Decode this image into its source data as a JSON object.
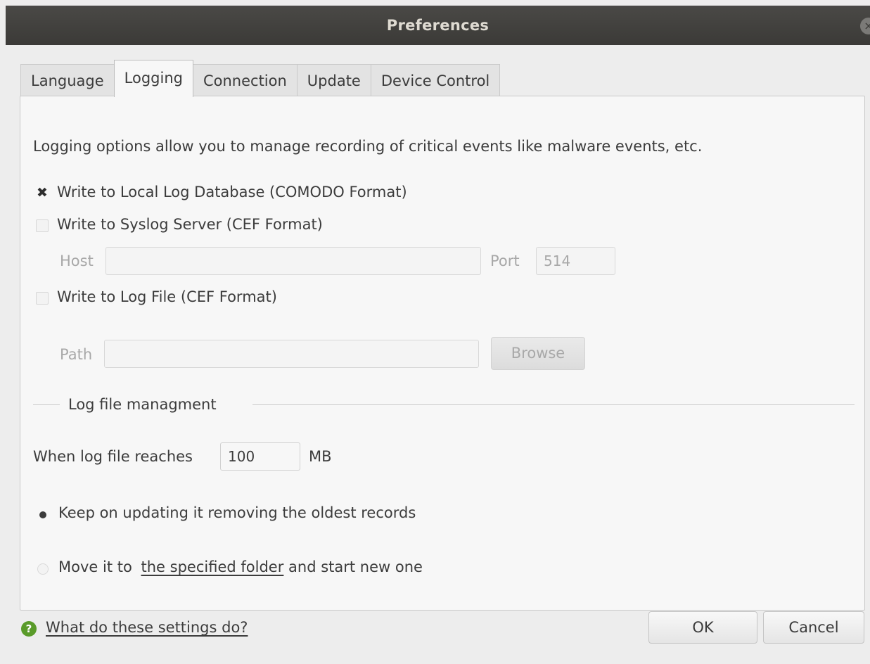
{
  "window": {
    "title": "Preferences",
    "close_glyph": "×"
  },
  "tabs": [
    {
      "label": "Language"
    },
    {
      "label": "Logging",
      "active": true
    },
    {
      "label": "Connection"
    },
    {
      "label": "Update"
    },
    {
      "label": "Device Control"
    }
  ],
  "logging": {
    "description": "Logging options allow you to manage recording of critical events like malware events, etc.",
    "local_db": {
      "label": "Write to Local Log Database (COMODO Format)",
      "checked": true,
      "mark": "✖"
    },
    "syslog": {
      "label": "Write to Syslog Server (CEF Format)",
      "checked": false
    },
    "host_label": "Host",
    "host_value": "",
    "port_label": "Port",
    "port_value": "514",
    "log_file": {
      "label": "Write to Log File (CEF Format)",
      "checked": false
    },
    "path_label": "Path",
    "path_value": "",
    "browse_label": "Browse"
  },
  "management": {
    "section_title": "Log file managment",
    "size_label": "When log file reaches",
    "size_value": "100",
    "size_unit": "MB",
    "option_keep": {
      "label": "Keep on updating it removing the oldest records",
      "selected": true
    },
    "option_move": {
      "prefix": "Move it to",
      "link": "the specified folder",
      "suffix": "and start new one",
      "selected": false
    }
  },
  "footer": {
    "help_icon": "help-icon",
    "help_glyph": "?",
    "help_link": "What do these settings do?",
    "ok_label": "OK",
    "cancel_label": "Cancel"
  },
  "colors": {
    "titlebar": "#3b3a37",
    "help_icon": "#5a9b2a",
    "panel": "#f7f7f7"
  }
}
